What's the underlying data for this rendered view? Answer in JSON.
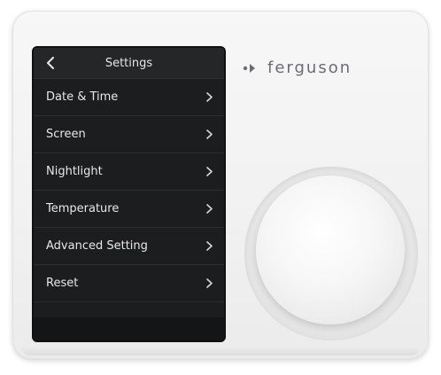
{
  "device": {
    "brand": "ferguson",
    "body_color": "#f2f2f2",
    "screen_color": "#1b1d1e"
  },
  "screen": {
    "back_icon": "chevron-left-icon",
    "title": "Settings",
    "items": [
      {
        "label": "Date & Time",
        "icon": "chevron-right-icon"
      },
      {
        "label": "Screen",
        "icon": "chevron-right-icon"
      },
      {
        "label": "Nightlight",
        "icon": "chevron-right-icon"
      },
      {
        "label": "Temperature",
        "icon": "chevron-right-icon"
      },
      {
        "label": "Advanced Setting",
        "icon": "chevron-right-icon"
      },
      {
        "label": "Reset",
        "icon": "chevron-right-icon"
      }
    ]
  }
}
